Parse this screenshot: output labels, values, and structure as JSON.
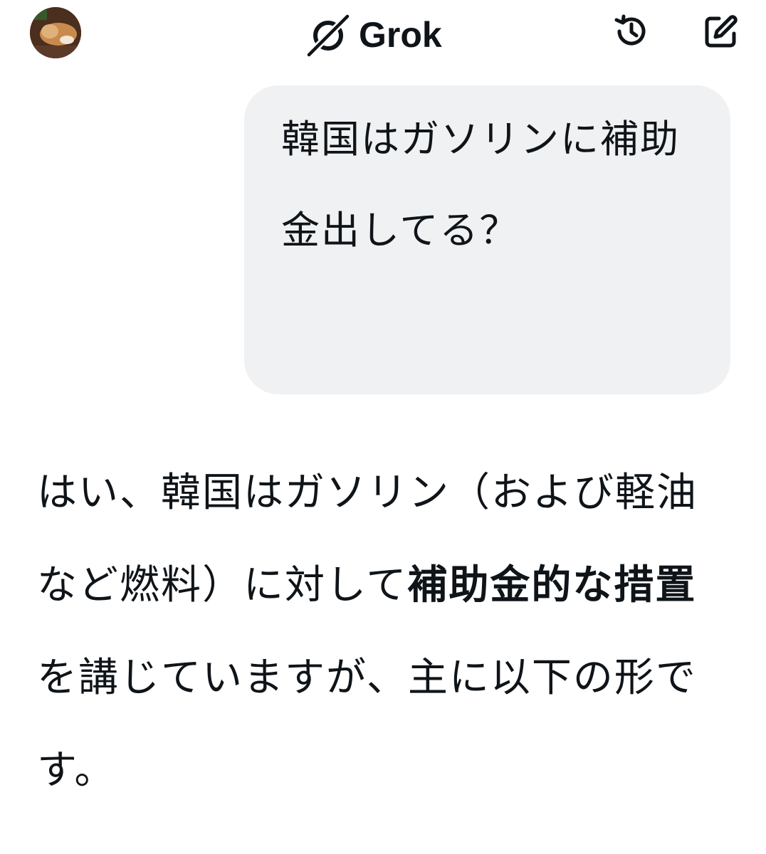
{
  "header": {
    "title": "Grok",
    "avatar_icon": "user-avatar",
    "logo_icon": "grok-logo-icon",
    "history_icon": "history-icon",
    "compose_icon": "new-chat-icon"
  },
  "conversation": {
    "user_message": "韓国はガソリンに補助金出してる？",
    "reply": {
      "part1": "はい、韓国はガソリン（および軽油など燃料）に対して",
      "bold": "補助金的な措置",
      "part2": "を講じていますが、主に以下の形です。"
    }
  },
  "colors": {
    "bubble_bg": "#eff1f2",
    "text": "#0f1419"
  }
}
